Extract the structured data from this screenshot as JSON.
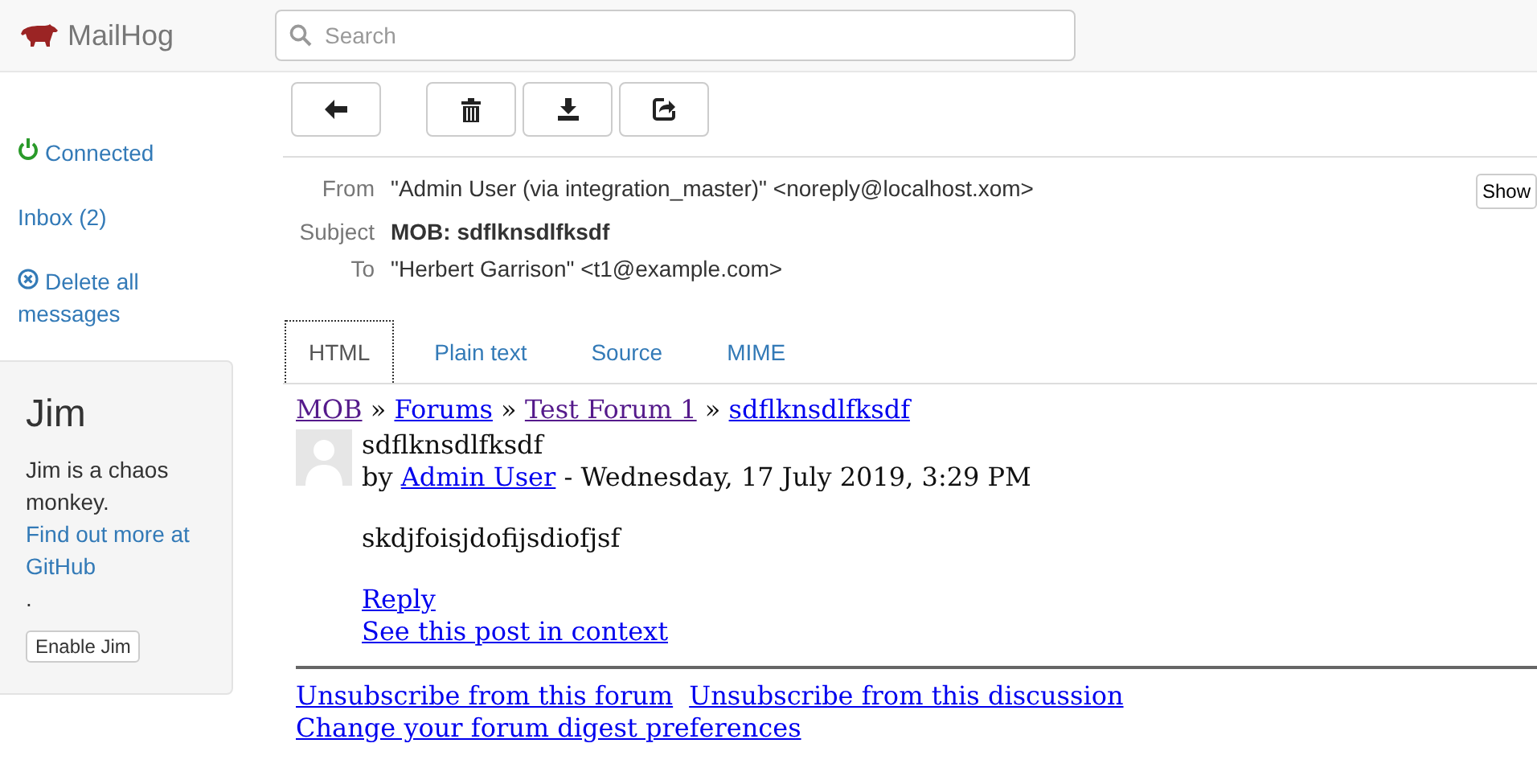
{
  "header": {
    "brand": "MailHog",
    "search": {
      "placeholder": "Search"
    }
  },
  "sidebar": {
    "items": [
      {
        "kind": "status",
        "label": "Connected"
      },
      {
        "kind": "link",
        "label": "Inbox (2)"
      },
      {
        "kind": "delete",
        "label": "Delete all messages"
      }
    ],
    "jim": {
      "title": "Jim",
      "text": "Jim is a chaos monkey.",
      "link": "Find out more at GitHub",
      "suffix": ".",
      "button": "Enable Jim"
    }
  },
  "toolbar": [
    {
      "kind": "back"
    },
    {
      "kind": "delete"
    },
    {
      "kind": "download"
    },
    {
      "kind": "release"
    }
  ],
  "headers": [
    {
      "label": "From",
      "value": "\"Admin User (via integration_master)\" <noreply@localhost.xom>",
      "bold": false
    },
    {
      "label": "Subject",
      "value": "MOB: sdflknsdlfksdf",
      "bold": true
    },
    {
      "label": "To",
      "value": "\"Herbert Garrison\" <t1@example.com>",
      "bold": false
    }
  ],
  "show_button": "Show",
  "tabs": [
    {
      "label": "HTML",
      "selected": true
    },
    {
      "label": "Plain text",
      "selected": false
    },
    {
      "label": "Source",
      "selected": false
    },
    {
      "label": "MIME",
      "selected": false
    }
  ],
  "body": {
    "breadcrumb": [
      {
        "label": "MOB",
        "visited": true
      },
      {
        "label": "Forums",
        "visited": false
      },
      {
        "label": "Test Forum 1",
        "visited": true
      },
      {
        "label": "sdflknsdlfksdf",
        "visited": false
      }
    ],
    "separator": "»",
    "post_title": "sdflknsdlfksdf",
    "by": "by",
    "author": "Admin User",
    "date": "- Wednesday, 17 July 2019, 3:29 PM",
    "message": "skdjfoisjdofijsdiofjsf",
    "actions": [
      "Reply",
      "See this post in context"
    ],
    "footer_links": [
      "Unsubscribe from this forum",
      "Unsubscribe from this discussion",
      "Change your forum digest preferences"
    ]
  }
}
